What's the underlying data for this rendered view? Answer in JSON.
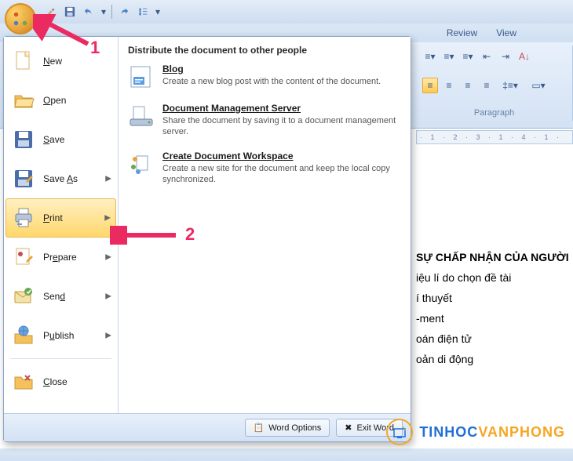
{
  "qat": {
    "icons": [
      "brush",
      "save",
      "undo",
      "dd",
      "redo",
      "spacing",
      "dd2"
    ]
  },
  "ribbon": {
    "tabs": [
      "Review",
      "View"
    ],
    "paragraph_label": "Paragraph"
  },
  "ruler_text": "· 1 · 2 · 3 · 1 · 4 · 1 ·",
  "doc_lines": [
    "SỰ CHẤP NHẬN CỦA NGƯỜI",
    "iệu lí do chọn đề tài",
    "í thuyết",
    "-ment",
    "oán điện tử",
    "oản di động"
  ],
  "office_menu": {
    "left": [
      {
        "label": "New",
        "ul": "N",
        "icon": "doc-new",
        "arrow": false
      },
      {
        "label": "Open",
        "ul": "O",
        "icon": "folder-open",
        "arrow": false
      },
      {
        "label": "Save",
        "ul": "S",
        "icon": "disk",
        "arrow": false
      },
      {
        "label": "Save As",
        "ul": "A",
        "icon": "disk-pen",
        "arrow": true
      },
      {
        "label": "Print",
        "ul": "P",
        "icon": "printer",
        "arrow": true,
        "hl": true
      },
      {
        "label": "Prepare",
        "ul": "e",
        "icon": "prepare",
        "arrow": true
      },
      {
        "label": "Send",
        "ul": "d",
        "icon": "send",
        "arrow": true
      },
      {
        "label": "Publish",
        "ul": "u",
        "icon": "publish",
        "arrow": true
      },
      {
        "label": "Close",
        "ul": "C",
        "icon": "close",
        "arrow": false
      }
    ],
    "right_title": "Distribute the document to other people",
    "right_items": [
      {
        "title": "Blog",
        "desc": "Create a new blog post with the content of the document.",
        "icon": "blog"
      },
      {
        "title": "Document Management Server",
        "desc": "Share the document by saving it to a document management server.",
        "icon": "dms"
      },
      {
        "title": "Create Document Workspace",
        "desc": "Create a new site for the document and keep the local copy synchronized.",
        "icon": "workspace"
      }
    ],
    "footer": {
      "options": "Word Options",
      "exit": "Exit Word"
    }
  },
  "annotations": {
    "one": "1",
    "two": "2"
  },
  "watermark": {
    "a": "TINHOC",
    "b": "VANPHONG"
  }
}
